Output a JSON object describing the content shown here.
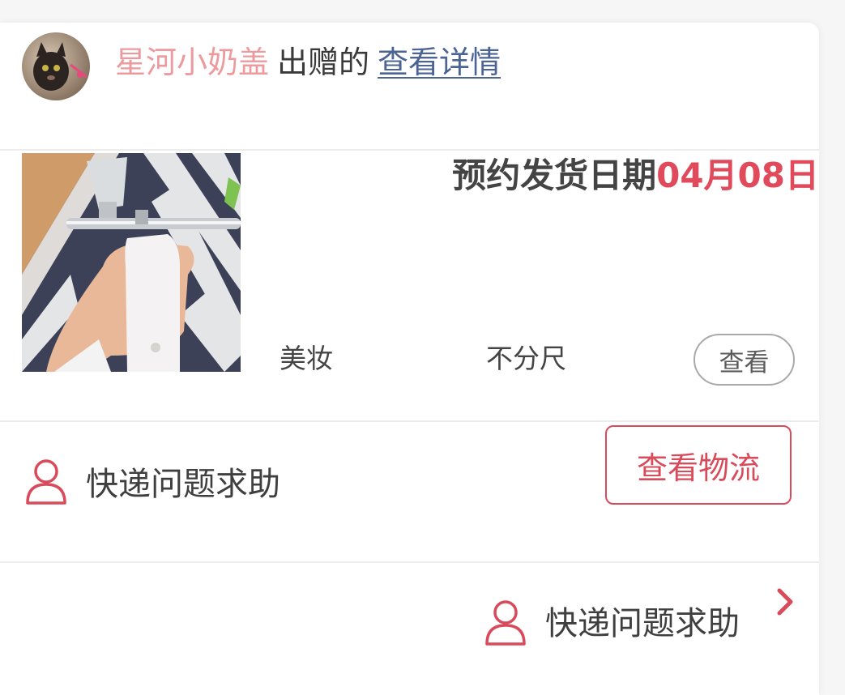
{
  "header": {
    "username": "星河小奶盖",
    "given_text": "出赠的",
    "details_link": "查看详情"
  },
  "product": {
    "ship_label": "预约发货日期",
    "ship_value": "04月08日",
    "category": "美妆",
    "size": "不分尺",
    "view_button": "查看"
  },
  "help_row": {
    "label": "快递问题求助",
    "logistics_button": "查看物流"
  },
  "footer_row": {
    "label": "快递问题求助"
  },
  "colors": {
    "accent": "#d94a5a",
    "username": "#ec9a9d",
    "link": "#4b6494"
  },
  "icons": {
    "person": "person-outline-icon",
    "chevron": "chevron-right-icon"
  }
}
